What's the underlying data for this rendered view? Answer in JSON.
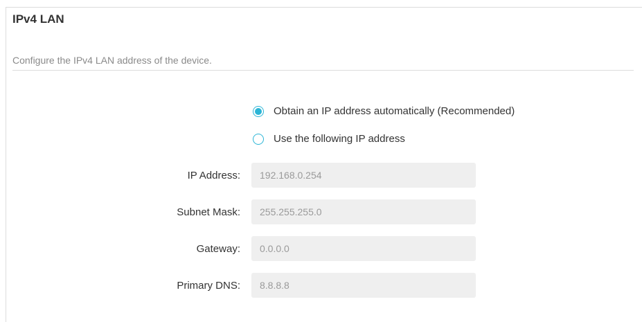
{
  "section": {
    "title": "IPv4 LAN",
    "description": "Configure the IPv4 LAN address of the device."
  },
  "mode": {
    "options": [
      {
        "label": "Obtain an IP address automatically (Recommended)",
        "selected": true
      },
      {
        "label": "Use the following IP address",
        "selected": false
      }
    ]
  },
  "fields": {
    "ip_address": {
      "label": "IP Address:",
      "value": "192.168.0.254"
    },
    "subnet_mask": {
      "label": "Subnet Mask:",
      "value": "255.255.255.0"
    },
    "gateway": {
      "label": "Gateway:",
      "value": "0.0.0.0"
    },
    "primary_dns": {
      "label": "Primary DNS:",
      "value": "8.8.8.8"
    }
  },
  "colors": {
    "accent": "#2cb5d6",
    "input_bg": "#efefef",
    "divider": "#dcdcdc"
  }
}
